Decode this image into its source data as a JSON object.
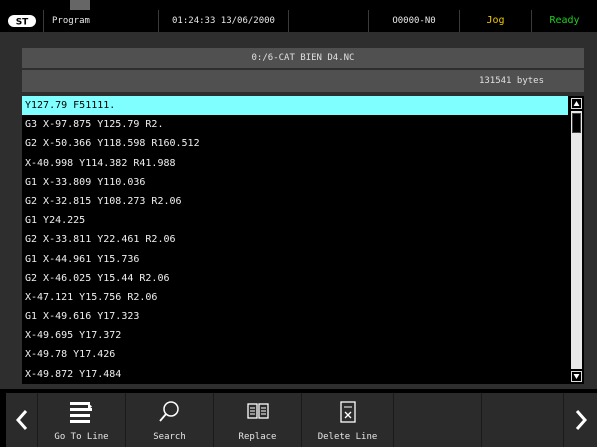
{
  "status": {
    "mode": "Program",
    "datetime": "01:24:33 13/06/2000",
    "program": "O0000-N0",
    "jog": "Jog",
    "ready": "Ready"
  },
  "file": {
    "path": "0:/6-CAT BIEN D4.NC",
    "size": "131541 bytes"
  },
  "lines": [
    "Y127.79 F51111.",
    "G3 X-97.875 Y125.79 R2.",
    "G2 X-50.366 Y118.598 R160.512",
    "X-40.998 Y114.382 R41.988",
    "G1 X-33.809 Y110.036",
    "G2 X-32.815 Y108.273 R2.06",
    "G1 Y24.225",
    "G2 X-33.811 Y22.461 R2.06",
    "G1 X-44.961 Y15.736",
    "G2 X-46.025 Y15.44 R2.06",
    "X-47.121 Y15.756 R2.06",
    "G1 X-49.616 Y17.323",
    "X-49.695 Y17.372",
    "X-49.78 Y17.426",
    "X-49.872 Y17.484"
  ],
  "softkeys": {
    "goto": "Go To Line",
    "search": "Search",
    "replace": "Replace",
    "delete": "Delete Line"
  },
  "icons": {
    "logo": "machine-logo-icon",
    "goto": "goto-line-icon",
    "search": "search-icon",
    "replace": "replace-icon",
    "delete": "delete-line-icon",
    "prev": "chevron-left-icon",
    "next": "chevron-right-icon"
  },
  "colors": {
    "selected_line": "#7fffff",
    "jog": "#f0c800",
    "ready": "#1dd01d"
  }
}
